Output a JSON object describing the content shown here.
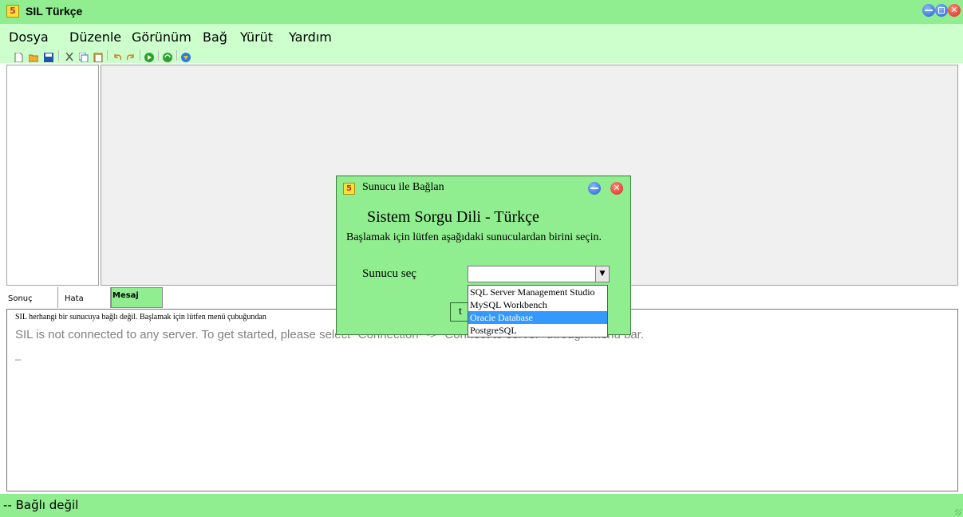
{
  "window": {
    "title": "SIL Türkçe",
    "icon": "sil-app-icon",
    "close_glyph": "✕"
  },
  "menu": [
    {
      "label": "Dosya"
    },
    {
      "label": "Düzenle"
    },
    {
      "label": "Görünüm"
    },
    {
      "label": "Bağ"
    },
    {
      "label": "Yürüt"
    },
    {
      "label": "Yardım"
    }
  ],
  "toolbar": {
    "icons": [
      "new-file-icon",
      "open-folder-icon",
      "save-icon",
      "cut-icon",
      "copy-icon",
      "paste-icon",
      "undo-icon",
      "redo-icon",
      "run-icon",
      "refresh-icon",
      "help-icon"
    ]
  },
  "tabs": [
    {
      "label": "Sonuç"
    },
    {
      "label": "Hata"
    },
    {
      "label": "Mesaj",
      "active": true
    }
  ],
  "output": {
    "line1": "SIL herhangi bir sunucuya bağlı değil. Başlamak için lütfen menü çubuğundan",
    "line2": "SIL is not connected to any server. To get started, please select \"Connection\" -> \"Connect to server\" through menu bar.",
    "line3": "_"
  },
  "status": {
    "text": "-- Bağlı değil"
  },
  "dialog": {
    "title": "Sunucu ile Bağlan",
    "heading": "Sistem Sorgu Dili - Türkçe",
    "description": "Başlamak için lütfen aşağıdaki sunuculardan birini seçin.",
    "server_label": "Sunucu seç",
    "server_value": "",
    "button_label": "t",
    "options": [
      {
        "label": "SQL Server Management Studio"
      },
      {
        "label": "MySQL Workbench"
      },
      {
        "label": "Oracle Database",
        "selected": true
      },
      {
        "label": "PostgreSQL"
      }
    ]
  },
  "colors": {
    "title_bg": "#90ee90",
    "menu_bg": "#ccffcc",
    "selected": "#3399ff"
  }
}
